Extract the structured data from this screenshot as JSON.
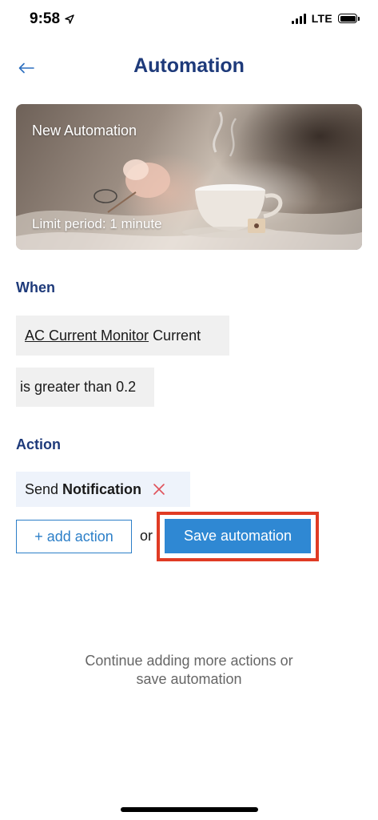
{
  "status_bar": {
    "time": "9:58",
    "network": "LTE",
    "icons": [
      "location-arrow-icon",
      "signal-icon",
      "battery-icon"
    ]
  },
  "header": {
    "title": "Automation",
    "back_icon": "arrow-left-icon"
  },
  "hero": {
    "name": "New Automation",
    "limit": "Limit period: 1 minute"
  },
  "when": {
    "heading": "When",
    "device": "AC Current Monitor",
    "attribute": "Current",
    "condition": "is greater than 0.2"
  },
  "action": {
    "heading": "Action",
    "item_prefix": "Send",
    "item_name": "Notification",
    "remove_icon": "close-icon"
  },
  "buttons": {
    "add_action": "+ add action",
    "or": "or",
    "save": "Save automation"
  },
  "hint": {
    "line1": "Continue adding more actions or",
    "line2": "save automation"
  },
  "colors": {
    "title_blue": "#1e3a7a",
    "button_blue": "#2f88d3",
    "highlight_red": "#e03b24",
    "remove_red": "#e0525a"
  }
}
